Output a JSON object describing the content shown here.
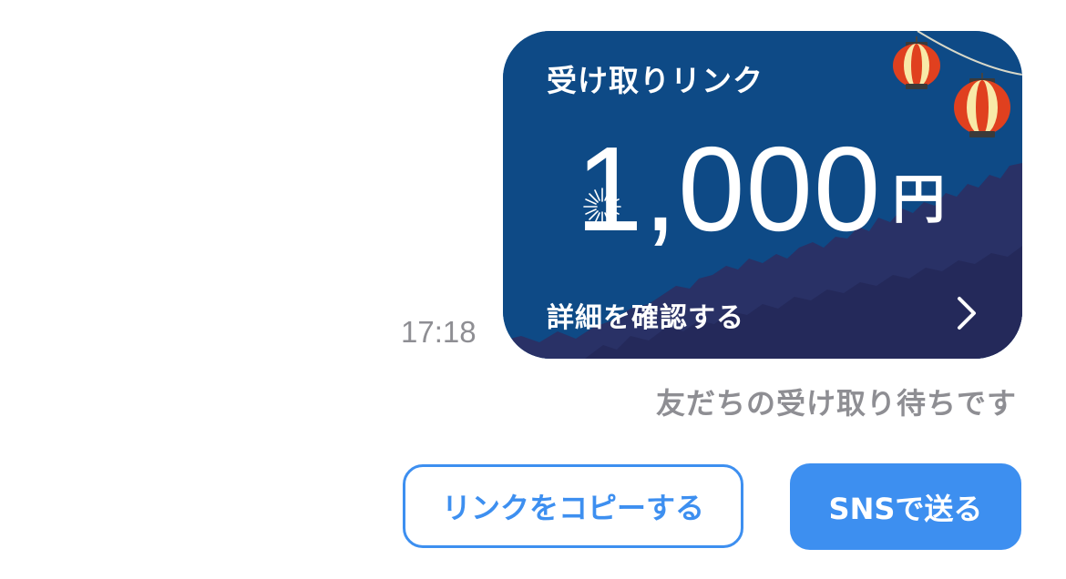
{
  "message": {
    "timestamp": "17:18",
    "status": "友だちの受け取り待ちです"
  },
  "card": {
    "title": "受け取りリンク",
    "amount": "1,000",
    "currency": "円",
    "details_label": "詳細を確認する",
    "details_icon": "chevron-right-icon",
    "decorations": [
      "lantern-icon",
      "lantern-icon",
      "firework-icon",
      "forest-silhouette"
    ],
    "colors": {
      "sky": "#0e4a86",
      "forest": "#293166",
      "lantern_red": "#e0401f",
      "lantern_cream": "#f8e9a8"
    }
  },
  "actions": {
    "copy_link_label": "リンクをコピーする",
    "send_sns_label": "SNSで送る",
    "accent": "#3d8ff0"
  }
}
